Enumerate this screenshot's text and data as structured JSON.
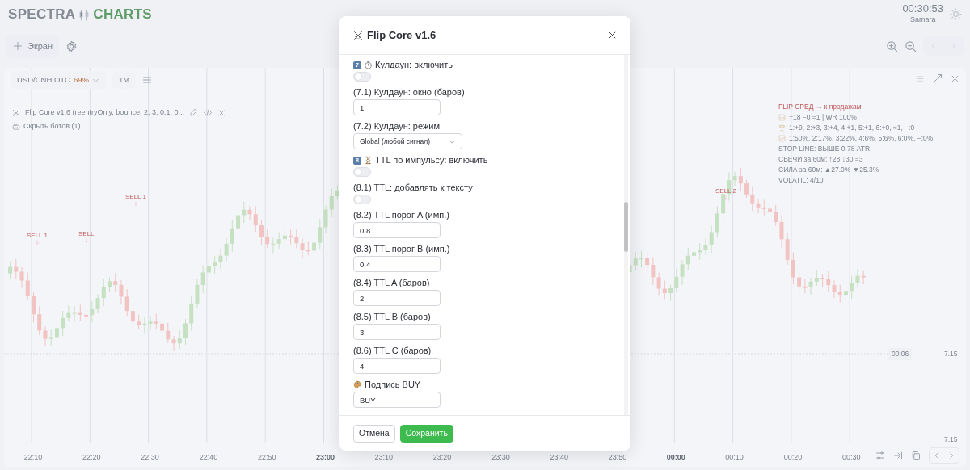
{
  "header": {
    "logo_first": "SPECTRA",
    "logo_second": "CHARTS",
    "clock": "00:30:53",
    "city": "Samara"
  },
  "toolbar": {
    "add_screen": "Экран"
  },
  "chart_panel": {
    "symbol": "USD/CNH OTC",
    "payout": "69%",
    "timeframe": "1M",
    "indicator": "Flip Core v1.6 (reentryOnly, bounce, 2, 3, 0.1, 0...",
    "hide_bots": "Скрыть ботов (1)",
    "info_lines": [
      {
        "kind": "headline",
        "text": "FLIP  СРЕД → к продажам"
      },
      {
        "kind": "stats",
        "text": "+18 −0 =1 | WR 100%"
      },
      {
        "kind": "trophy",
        "text": "1:+9, 2:+3, 3:+4, 4:+1, 5:+1, 6:+0, ≈1, −:0"
      },
      {
        "kind": "percent",
        "text": "1:50%, 2:17%, 3:22%, 4:6%, 5:6%, 6:0%, −:0%"
      },
      {
        "kind": "plain",
        "text": "STOP LINE: ВЫШЕ 0.78 ATR"
      },
      {
        "kind": "plain",
        "text": "СВЕЧИ за 60м: ↑28 ↓30 =3"
      },
      {
        "kind": "plain",
        "text": "СИЛА за 60м: ▲27.0% ▼25.3%"
      },
      {
        "kind": "plain",
        "text": "VOLATIL: 4/10"
      }
    ],
    "signals": [
      "SELL 1",
      "SELL",
      "SELL 1",
      "SELL 2"
    ],
    "price_timer": "00:06",
    "price": "7.15",
    "scale_price": "7.15",
    "time_labels": [
      {
        "text": "22:10",
        "bold": false
      },
      {
        "text": "22:20",
        "bold": false
      },
      {
        "text": "22:30",
        "bold": false
      },
      {
        "text": "22:40",
        "bold": false
      },
      {
        "text": "22:50",
        "bold": false
      },
      {
        "text": "23:00",
        "bold": true
      },
      {
        "text": "23:10",
        "bold": false
      },
      {
        "text": "23:20",
        "bold": false
      },
      {
        "text": "23:30",
        "bold": false
      },
      {
        "text": "23:40",
        "bold": false
      },
      {
        "text": "23:50",
        "bold": false
      },
      {
        "text": "00:00",
        "bold": true
      },
      {
        "text": "00:10",
        "bold": false
      },
      {
        "text": "00:20",
        "bold": false
      },
      {
        "text": "00:30",
        "bold": false
      }
    ]
  },
  "dialog": {
    "title": "Flip Core v1.6",
    "fields": [
      {
        "kind": "toggle",
        "badge": "7",
        "label": "Кулдаун: включить",
        "on": false
      },
      {
        "kind": "number",
        "label": "(7.1) Кулдаун: окно (баров)",
        "value": "1"
      },
      {
        "kind": "select",
        "label": "(7.2) Кулдаун: режим",
        "value": "Global (любой сигнал)"
      },
      {
        "kind": "toggle",
        "badge": "8",
        "label": "TTL по импульсу: включить",
        "on": false
      },
      {
        "kind": "toggle",
        "label": "(8.1) TTL: добавлять к тексту",
        "on": false
      },
      {
        "kind": "number",
        "label": "(8.2) TTL порог A (имп.)",
        "value": "0,8"
      },
      {
        "kind": "number",
        "label": "(8.3) TTL порог B (имп.)",
        "value": "0,4"
      },
      {
        "kind": "number",
        "label": "(8.4) TTL A (баров)",
        "value": "2"
      },
      {
        "kind": "number",
        "label": "(8.5) TTL B (баров)",
        "value": "3"
      },
      {
        "kind": "number",
        "label": "(8.6) TTL C (баров)",
        "value": "4"
      },
      {
        "kind": "text",
        "label": "Подпись BUY",
        "value": "BUY"
      }
    ],
    "buttons": [
      {
        "kind": "secondary",
        "text": "Отмена"
      },
      {
        "kind": "primary",
        "text": "Сохранить"
      }
    ]
  }
}
